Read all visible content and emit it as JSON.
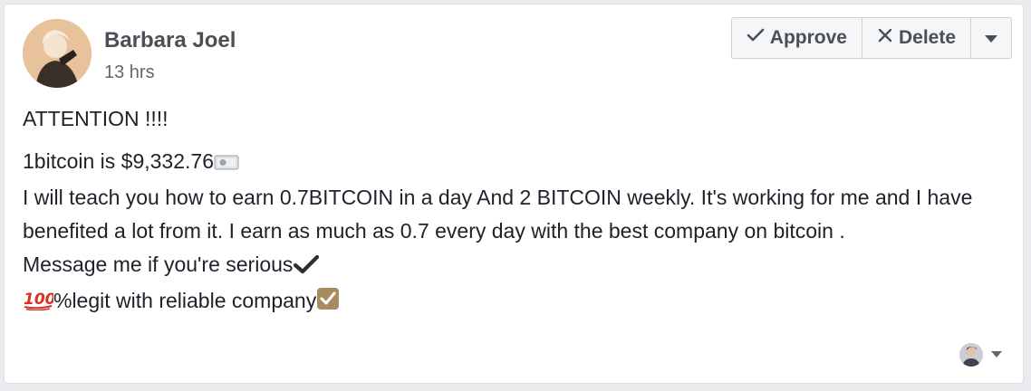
{
  "post": {
    "author": "Barbara Joel",
    "time": "13 hrs",
    "lines": [
      "ATTENTION !!!!",
      "1bitcoin is $9,332.76",
      "I will teach you how to earn 0.7BITCOIN in a day And 2 BITCOIN weekly. It's working for me and I have benefited a lot from it. I earn as much as 0.7 every day with the best company on bitcoin .",
      "Message me if you're serious",
      "%legit with reliable company"
    ]
  },
  "actions": {
    "approve_label": "Approve",
    "delete_label": "Delete"
  },
  "icons": {
    "approve": "check-icon",
    "delete": "x-icon",
    "more": "caret-down-icon",
    "money": "banknote-icon",
    "heavy_check": "heavy-check-icon",
    "hundred": "hundred-points-icon",
    "check_box": "check-box-icon"
  },
  "colors": {
    "text": "#1d2129",
    "secondary": "#616770",
    "button_bg": "#f5f6f7",
    "check_box": "#a88b5e",
    "hundred": "#d93025"
  }
}
